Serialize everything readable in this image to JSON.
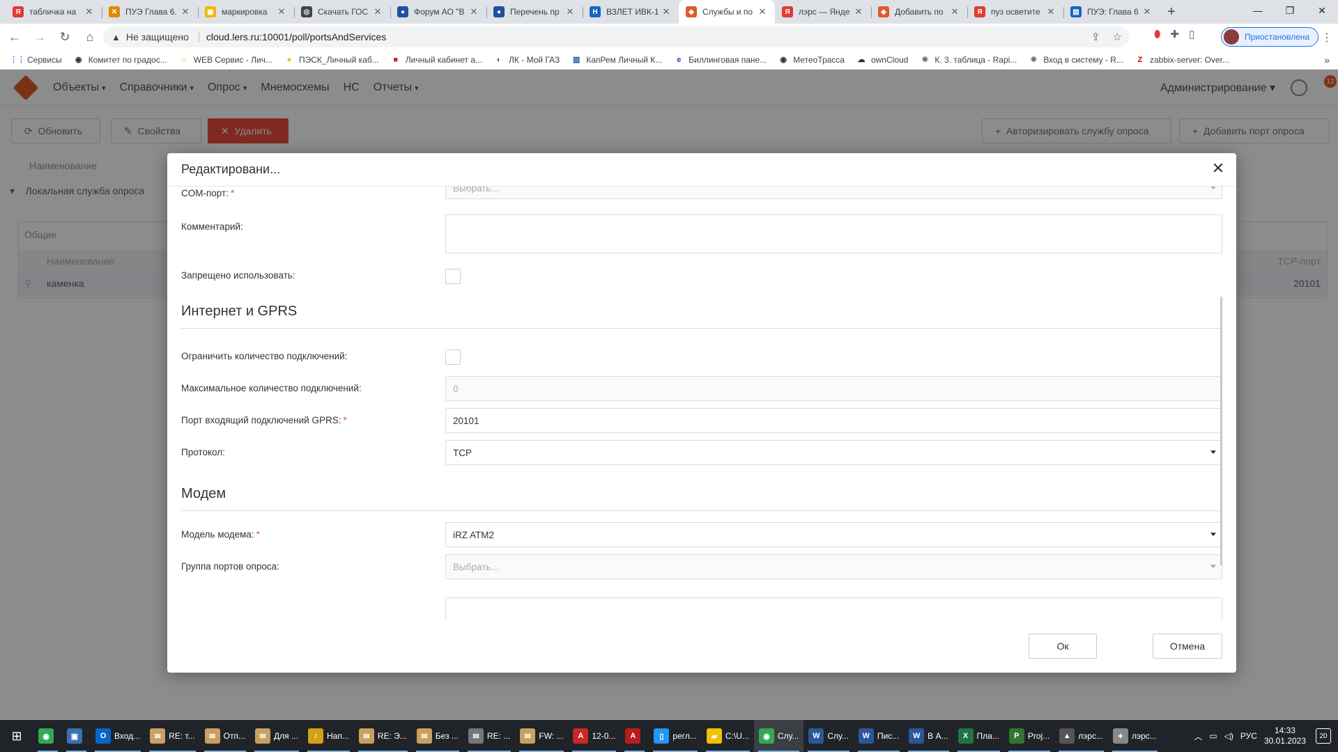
{
  "browser": {
    "tabs": [
      {
        "title": "табличка на",
        "icon_text": "Я",
        "icon_color": "#e53935",
        "active": false
      },
      {
        "title": "ПУЭ Глава 6.",
        "icon_text": "✕",
        "icon_color": "#e08a00",
        "active": false
      },
      {
        "title": "маркировка",
        "icon_text": "▣",
        "icon_color": "#f4b400",
        "active": false
      },
      {
        "title": "Скачать ГОС",
        "icon_text": "◎",
        "icon_color": "#444444",
        "active": false
      },
      {
        "title": "Форум АО \"В",
        "icon_text": "●",
        "icon_color": "#1e4fa3",
        "active": false
      },
      {
        "title": "Перечень пр",
        "icon_text": "●",
        "icon_color": "#1e4fa3",
        "active": false
      },
      {
        "title": "ВЗЛЕТ ИВК-1",
        "icon_text": "Н",
        "icon_color": "#1565c0",
        "active": false
      },
      {
        "title": "Службы и по",
        "icon_text": "◆",
        "icon_color": "#e05a2b",
        "active": true
      },
      {
        "title": "лэрс — Янде",
        "icon_text": "Я",
        "icon_color": "#e53935",
        "active": false
      },
      {
        "title": "Добавить по",
        "icon_text": "◆",
        "icon_color": "#e05a2b",
        "active": false
      },
      {
        "title": "пуз осветите",
        "icon_text": "Я",
        "icon_color": "#e53935",
        "active": false
      },
      {
        "title": "ПУЭ: Глава 6",
        "icon_text": "▤",
        "icon_color": "#1565c0",
        "active": false
      }
    ],
    "not_secure_label": "Не защищено",
    "url": "cloud.lers.ru:10001/poll/portsAndServices",
    "profile_label": "Приостановлена",
    "bookmarks": [
      {
        "label": "Сервисы",
        "icon": "apps-icon",
        "icon_text": "⋮⋮",
        "icon_color": "#4285f4"
      },
      {
        "label": "Комитет по градос...",
        "icon": "globe-icon",
        "icon_text": "◉",
        "icon_color": "#333333"
      },
      {
        "label": "WEB Сервис - Лич...",
        "icon": "home-icon",
        "icon_text": "⌂",
        "icon_color": "#e0a000"
      },
      {
        "label": "ПЭСК_Личный каб...",
        "icon": "bulb-icon",
        "icon_text": "●",
        "icon_color": "#f2c200"
      },
      {
        "label": "Личный кабинет а...",
        "icon": "box-icon",
        "icon_text": "■",
        "icon_color": "#c62828"
      },
      {
        "label": "ЛК - Мой ГАЗ",
        "icon": "flame-icon",
        "icon_text": "◐",
        "icon_color": "#1565c0"
      },
      {
        "label": "КапРем Личный К...",
        "icon": "building-icon",
        "icon_text": "▥",
        "icon_color": "#1e4fa3"
      },
      {
        "label": "Биллинговая пане...",
        "icon": "e-icon",
        "icon_text": "e",
        "icon_color": "#1e4fa3"
      },
      {
        "label": "МетеоТрасса",
        "icon": "globe-icon",
        "icon_text": "◉",
        "icon_color": "#333333"
      },
      {
        "label": "ownCloud",
        "icon": "cloud-icon",
        "icon_text": "☁",
        "icon_color": "#1d2d44"
      },
      {
        "label": "К. 3. таблица - Rapi...",
        "icon": "gear-icon",
        "icon_text": "✹",
        "icon_color": "#777777"
      },
      {
        "label": "Вход в систему - R...",
        "icon": "gear-icon",
        "icon_text": "✹",
        "icon_color": "#777777"
      },
      {
        "label": "zabbix-server: Over...",
        "icon": "zabbix-icon",
        "icon_text": "Z",
        "icon_color": "#d40000"
      }
    ]
  },
  "app": {
    "menu": [
      "Объекты",
      "Справочники",
      "Опрос",
      "Мнемосхемы",
      "НС",
      "Отчеты"
    ],
    "menu_has_caret": [
      true,
      true,
      true,
      false,
      false,
      true
    ],
    "admin_label": "Администрирование",
    "notif_count": "12",
    "toolbar": {
      "refresh": "Обновить",
      "properties": "Свойства",
      "delete": "Удалить",
      "authorize": "Авторизировать службу опроса",
      "add_port": "Добавить порт опроса"
    },
    "column_name": "Наименование",
    "tree_item": "Локальная служба опроса",
    "panel": {
      "title": "Общие",
      "col_name": "Наименование",
      "col_tcp": "TCP-порт",
      "row_name": "каменка",
      "row_tcp": "20101"
    }
  },
  "modal": {
    "title": "Редактировани...",
    "fields": {
      "com_port": {
        "label": "COM-порт:",
        "placeholder": "Выбрать..."
      },
      "comment": {
        "label": "Комментарий:",
        "value": ""
      },
      "forbidden": {
        "label": "Запрещено использовать:",
        "checked": false
      },
      "limit_connections": {
        "label": "Ограничить количество подключений:",
        "checked": false
      },
      "max_connections": {
        "label": "Максимальное количество подключений:",
        "value": "0"
      },
      "gprs_port": {
        "label": "Порт входящий подключений GPRS:",
        "value": "20101"
      },
      "protocol": {
        "label": "Протокол:",
        "value": "TCP"
      },
      "modem_model": {
        "label": "Модель модема:",
        "value": "iRZ ATM2"
      },
      "port_group": {
        "label": "Группа портов опроса:",
        "placeholder": "Выбрать..."
      }
    },
    "sections": {
      "internet": "Интернет и GPRS",
      "modem": "Модем"
    },
    "ok_label": "Ок",
    "cancel_label": "Отмена"
  },
  "taskbar": {
    "items": [
      {
        "label": "",
        "icon": "chrome-icon",
        "icon_text": "◉",
        "icon_color": "#34a853"
      },
      {
        "label": "",
        "icon": "app-icon",
        "icon_text": "▣",
        "icon_color": "#3b6fb6"
      },
      {
        "label": "Вход...",
        "icon": "outlook-icon",
        "icon_text": "O",
        "icon_color": "#0a64c8"
      },
      {
        "label": "RE: т...",
        "icon": "mail-icon",
        "icon_text": "✉",
        "icon_color": "#c8a060"
      },
      {
        "label": "Отп...",
        "icon": "mail-icon",
        "icon_text": "✉",
        "icon_color": "#c8a060"
      },
      {
        "label": "Для ...",
        "icon": "mail-icon",
        "icon_text": "✉",
        "icon_color": "#c8a060"
      },
      {
        "label": "Нап...",
        "icon": "bell-icon",
        "icon_text": "♪",
        "icon_color": "#d4a017"
      },
      {
        "label": "RE: Э...",
        "icon": "mail-icon",
        "icon_text": "✉",
        "icon_color": "#c8a060"
      },
      {
        "label": "Без ...",
        "icon": "mail-icon",
        "icon_text": "✉",
        "icon_color": "#c8a060"
      },
      {
        "label": "RE: ...",
        "icon": "mail-icon",
        "icon_text": "✉",
        "icon_color": "#777777"
      },
      {
        "label": "FW: ...",
        "icon": "mail-icon",
        "icon_text": "✉",
        "icon_color": "#c8a060"
      },
      {
        "label": "12-0...",
        "icon": "pdf-icon",
        "icon_text": "A",
        "icon_color": "#c62828"
      },
      {
        "label": "",
        "icon": "acrobat-icon",
        "icon_text": "A",
        "icon_color": "#b71c1c"
      },
      {
        "label": "регл...",
        "icon": "doc-icon",
        "icon_text": "▯",
        "icon_color": "#2196f3"
      },
      {
        "label": "C:\\U...",
        "icon": "folder-icon",
        "icon_text": "▰",
        "icon_color": "#f2c200"
      },
      {
        "label": "Слу...",
        "icon": "chrome-icon",
        "icon_text": "◉",
        "icon_color": "#34a853"
      },
      {
        "label": "Слу...",
        "icon": "word-icon",
        "icon_text": "W",
        "icon_color": "#2b579a"
      },
      {
        "label": "Пис...",
        "icon": "word-icon",
        "icon_text": "W",
        "icon_color": "#2b579a"
      },
      {
        "label": "В А...",
        "icon": "word-icon",
        "icon_text": "W",
        "icon_color": "#2b579a"
      },
      {
        "label": "Пла...",
        "icon": "excel-icon",
        "icon_text": "X",
        "icon_color": "#217346"
      },
      {
        "label": "Proj...",
        "icon": "project-icon",
        "icon_text": "P",
        "icon_color": "#31752f"
      },
      {
        "label": "лэрс...",
        "icon": "image-icon",
        "icon_text": "▲",
        "icon_color": "#555555"
      },
      {
        "label": "лэрс...",
        "icon": "satellite-icon",
        "icon_text": "✦",
        "icon_color": "#888888"
      }
    ],
    "active_index": 15,
    "language": "РУС",
    "time": "14:33",
    "date": "30.01.2023",
    "notif_count": "20"
  }
}
